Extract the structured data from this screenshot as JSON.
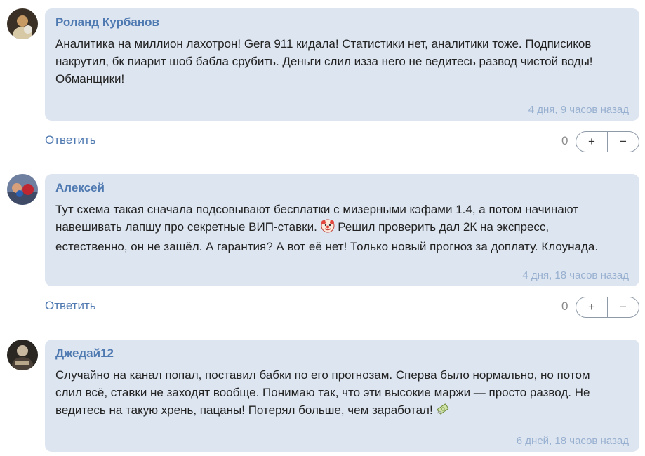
{
  "comments": [
    {
      "author": "Роланд Курбанов",
      "lines": [
        "Аналитика на миллион лахотрон! Gera 911 кидала! Статистики нет, аналитики тоже. Подписиков",
        "накрутил, бк пиарит шоб бабла срубить. Деньги слил изза него не ведитесь развод чистой воды!",
        "Обманщики!"
      ],
      "time": "4 дня, 9 часов назад",
      "reply": "Ответить",
      "score": "0",
      "plus": "+",
      "minus": "−"
    },
    {
      "author": "Алексей",
      "lines": [
        "Тут схема такая сначала подсовывают бесплатки с мизерными кэфами 1.4, а потом начинают",
        "навешивать лапшу про секретные ВИП-ставки.",
        "Решил проверить дал 2К на экспресс,",
        "естественно, он не зашёл. А гарантия? А вот её нет! Только новый прогноз за доплату. Клоунада."
      ],
      "emoji": "clown-face-icon",
      "time": "4 дня, 18 часов назад",
      "reply": "Ответить",
      "score": "0",
      "plus": "+",
      "minus": "−"
    },
    {
      "author": "Джедай12",
      "lines": [
        "Случайно на канал попал, поставил бабки по его прогнозам. Сперва было нормально, но потом",
        "слил всё, ставки не заходят вообще. Понимаю так, что эти высокие маржи — просто развод. Не",
        "ведитесь на такую хрень, пацаны! Потерял больше, чем заработал!"
      ],
      "emoji": "money-with-wings-icon",
      "time": "6 дней, 18 часов назад"
    }
  ],
  "colors": {
    "bubble": "#dde5f0",
    "author": "#4f79b1",
    "time": "#98b0d0",
    "text": "#222222"
  }
}
